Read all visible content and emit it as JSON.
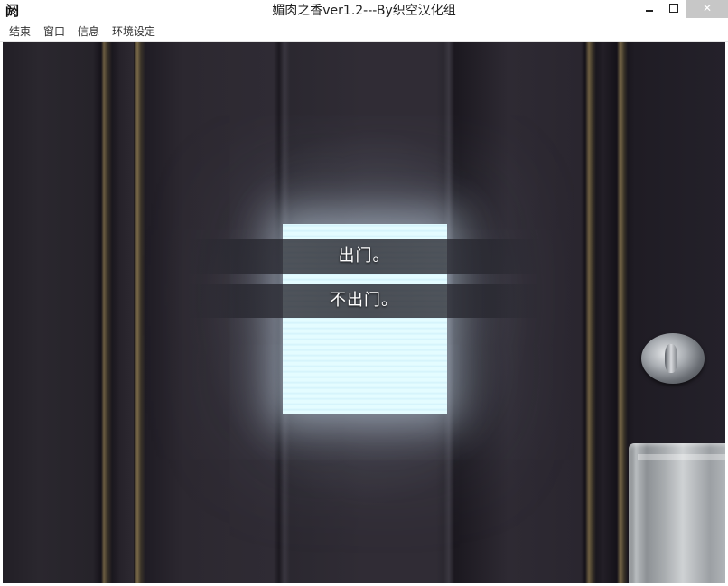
{
  "window": {
    "title": "媚肉之香ver1.2---By织空汉化组",
    "icon": "app-icon"
  },
  "menu": {
    "items": [
      "结束",
      "窗口",
      "信息",
      "环境设定"
    ]
  },
  "game": {
    "choices": [
      "出门。",
      "不出门。"
    ]
  }
}
